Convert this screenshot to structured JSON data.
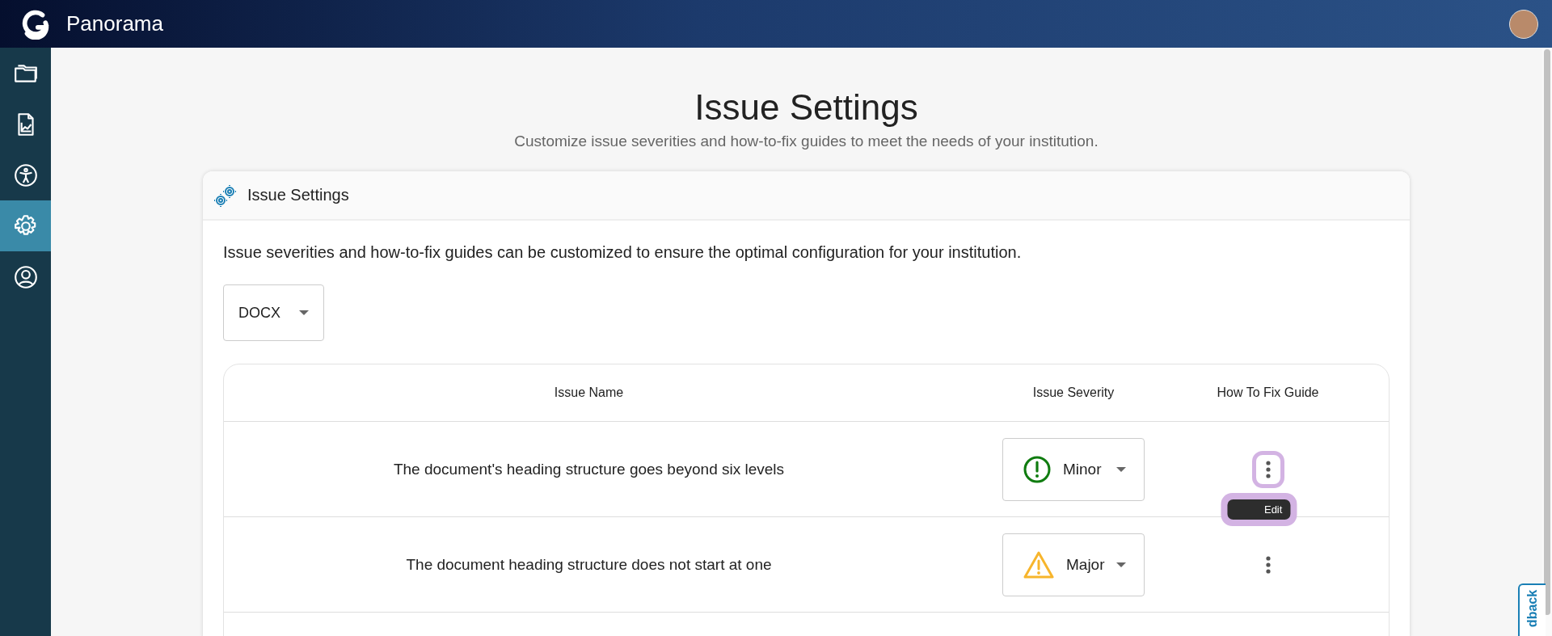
{
  "app": {
    "title": "Panorama"
  },
  "sidebar": {
    "items": [
      {
        "selected": false
      },
      {
        "selected": false
      },
      {
        "selected": false
      },
      {
        "selected": true
      },
      {
        "selected": false
      }
    ]
  },
  "page": {
    "title": "Issue Settings",
    "subtitle": "Customize issue severities and how-to-fix guides to meet the needs of your institution."
  },
  "card": {
    "title": "Issue Settings",
    "description": "Issue severities and how-to-fix guides can be customized to ensure the optimal configuration for your institution.",
    "file_type": {
      "value": "DOCX"
    }
  },
  "table": {
    "columns": [
      "Issue Name",
      "Issue Severity",
      "How To Fix Guide"
    ],
    "rows": [
      {
        "name": "The document's heading structure goes beyond six levels",
        "severity": {
          "label": "Minor",
          "kind": "minor"
        },
        "menu_open": true,
        "menu_items": [
          "Edit"
        ]
      },
      {
        "name": "The document heading structure does not start at one",
        "severity": {
          "label": "Major",
          "kind": "major"
        },
        "menu_open": false
      }
    ]
  },
  "feedback_tab": {
    "label": "dback"
  }
}
